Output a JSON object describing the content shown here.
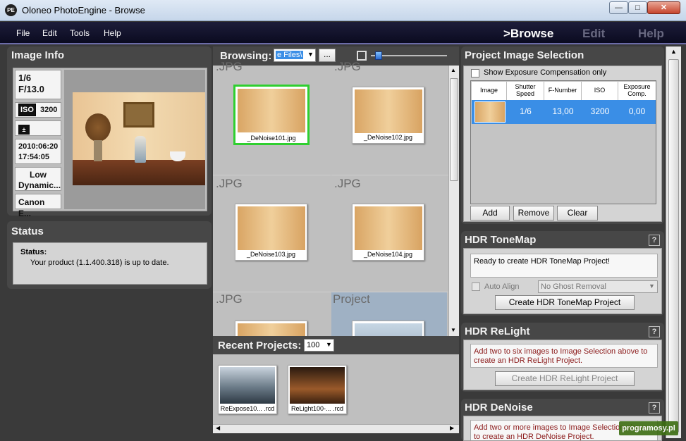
{
  "window": {
    "title": "Oloneo PhotoEngine - Browse",
    "logo": "PE",
    "min": "—",
    "max": "□",
    "close": "✕"
  },
  "menu": [
    "File",
    "Edit",
    "Tools",
    "Help"
  ],
  "modes": {
    "browse": ">Browse",
    "edit": "Edit",
    "help": "Help"
  },
  "image_info": {
    "title": "Image Info",
    "shutter": "1/6",
    "fnumber": "F/13.0",
    "iso_label": "ISO",
    "iso_value": "3200",
    "date": "2010:06:20",
    "time": "17:54:05",
    "dynamic_1": "Low",
    "dynamic_2": "Dynamic...",
    "camera": "Canon E..."
  },
  "status": {
    "title": "Status",
    "label": "Status:",
    "message": "Your product (1.1.400.318) is up to date."
  },
  "browsing": {
    "label": "Browsing:",
    "filter_value": "e Files\\",
    "more_button": "...",
    "cells": [
      {
        "type_label": ".JPG",
        "file": "_DeNoise101.jpg"
      },
      {
        "type_label": ".JPG",
        "file": "_DeNoise102.jpg"
      },
      {
        "type_label": ".JPG",
        "file": "_DeNoise103.jpg"
      },
      {
        "type_label": ".JPG",
        "file": "_DeNoise104.jpg"
      },
      {
        "type_label": ".JPG",
        "file": ""
      },
      {
        "type_label": "Project",
        "file": ""
      }
    ]
  },
  "recent": {
    "label": "Recent Projects:",
    "count": "100",
    "items": [
      {
        "name": "ReExpose10... .rcd"
      },
      {
        "name": "ReLight100-... .rcd"
      }
    ]
  },
  "selection": {
    "title": "Project Image Selection",
    "show_exposure": "Show Exposure Compensation only",
    "columns": [
      "Image",
      "Shutter Speed",
      "F-Number",
      "ISO",
      "Exposure Comp."
    ],
    "rows": [
      {
        "shutter": "1/6",
        "fnumber": "13,00",
        "iso": "3200",
        "exposure": "0,00"
      }
    ],
    "add": "Add",
    "remove": "Remove",
    "clear": "Clear"
  },
  "tonemap": {
    "title": "HDR ToneMap",
    "help": "?",
    "message": "Ready to create HDR ToneMap Project!",
    "auto_align": "Auto Align",
    "ghost": "No Ghost Removal",
    "create": "Create HDR ToneMap Project"
  },
  "relight": {
    "title": "HDR ReLight",
    "help": "?",
    "message": "Add two to six images to Image Selection above to create an HDR ReLight Project.",
    "create": "Create HDR ReLight Project"
  },
  "denoise": {
    "title": "HDR DeNoise",
    "help": "?",
    "message": "Add two or more images to Image Selection above to create an HDR DeNoise Project."
  },
  "watermark": "programosy.pl",
  "colors": {
    "accent_blue": "#3a8ee6",
    "selected_green": "#2fcf2f",
    "error_red": "#8b1a1a"
  }
}
